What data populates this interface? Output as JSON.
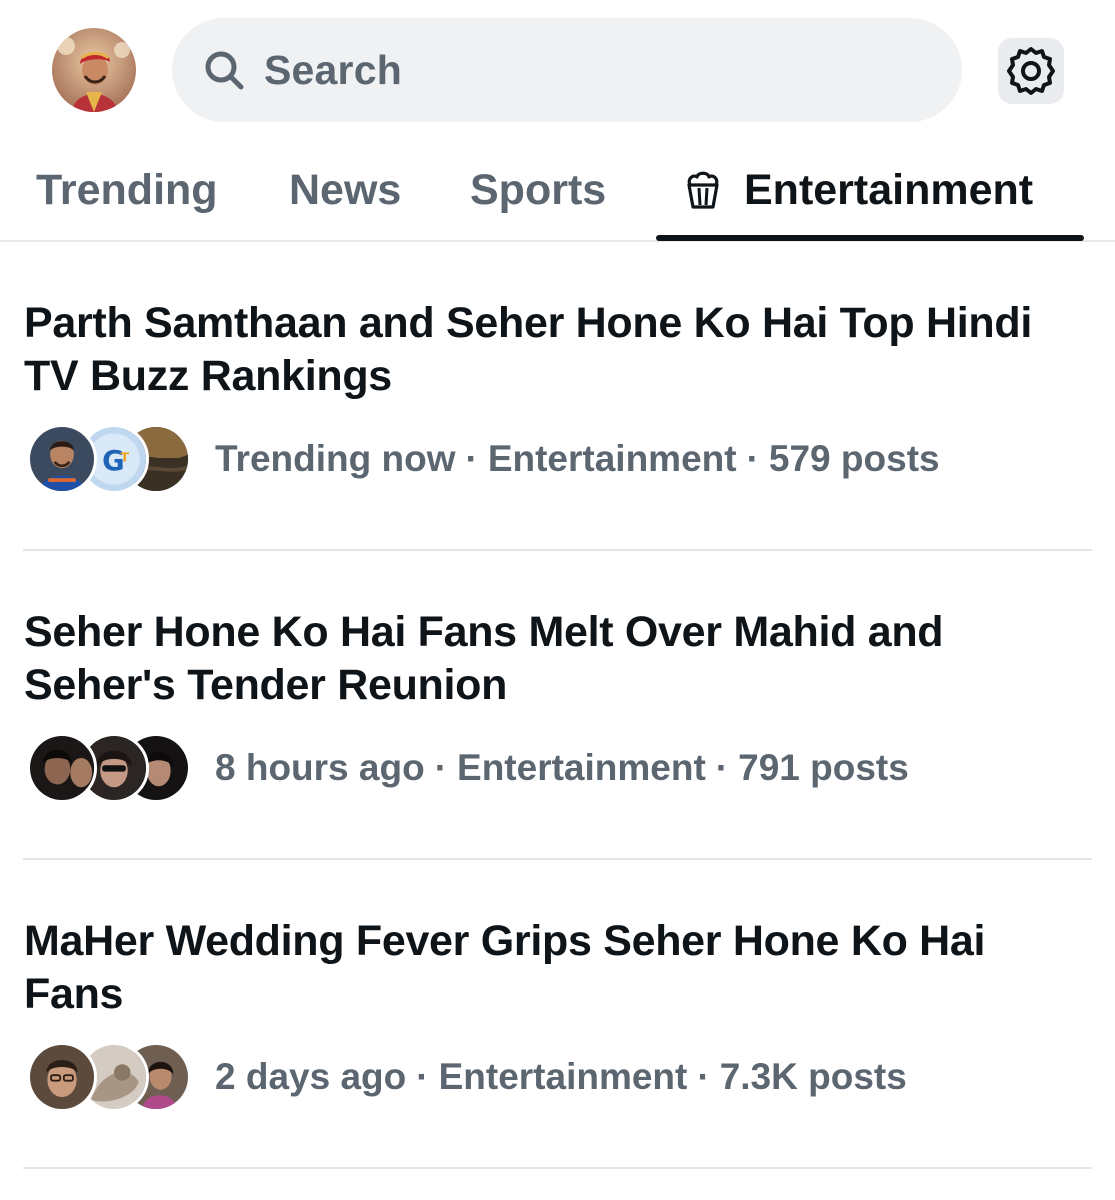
{
  "header": {
    "search_placeholder": "Search",
    "avatar": "user-avatar",
    "settings_icon": "gear-icon"
  },
  "tabs": [
    {
      "label": "Trending",
      "active": false
    },
    {
      "label": "News",
      "active": false
    },
    {
      "label": "Sports",
      "active": false
    },
    {
      "label": "Entertainment",
      "active": true,
      "icon": "popcorn-icon"
    }
  ],
  "trends": [
    {
      "title": "Parth Samthaan and Seher Hone Ko Hai Top Hindi TV Buzz Rankings",
      "time": "Trending now",
      "category": "Entertainment",
      "posts": "579 posts"
    },
    {
      "title": "Seher Hone Ko Hai Fans Melt Over Mahid and Seher's Tender Reunion",
      "time": "8 hours ago",
      "category": "Entertainment",
      "posts": "791 posts"
    },
    {
      "title": "MaHer Wedding Fever Grips Seher Hone Ko Hai Fans",
      "time": "2 days ago",
      "category": "Entertainment",
      "posts": "7.3K posts"
    }
  ],
  "separator": "·",
  "colors": {
    "text_primary": "#0f1419",
    "text_secondary": "#5b6670",
    "search_bg": "#eff1f3",
    "divider": "#e3e6e9"
  }
}
